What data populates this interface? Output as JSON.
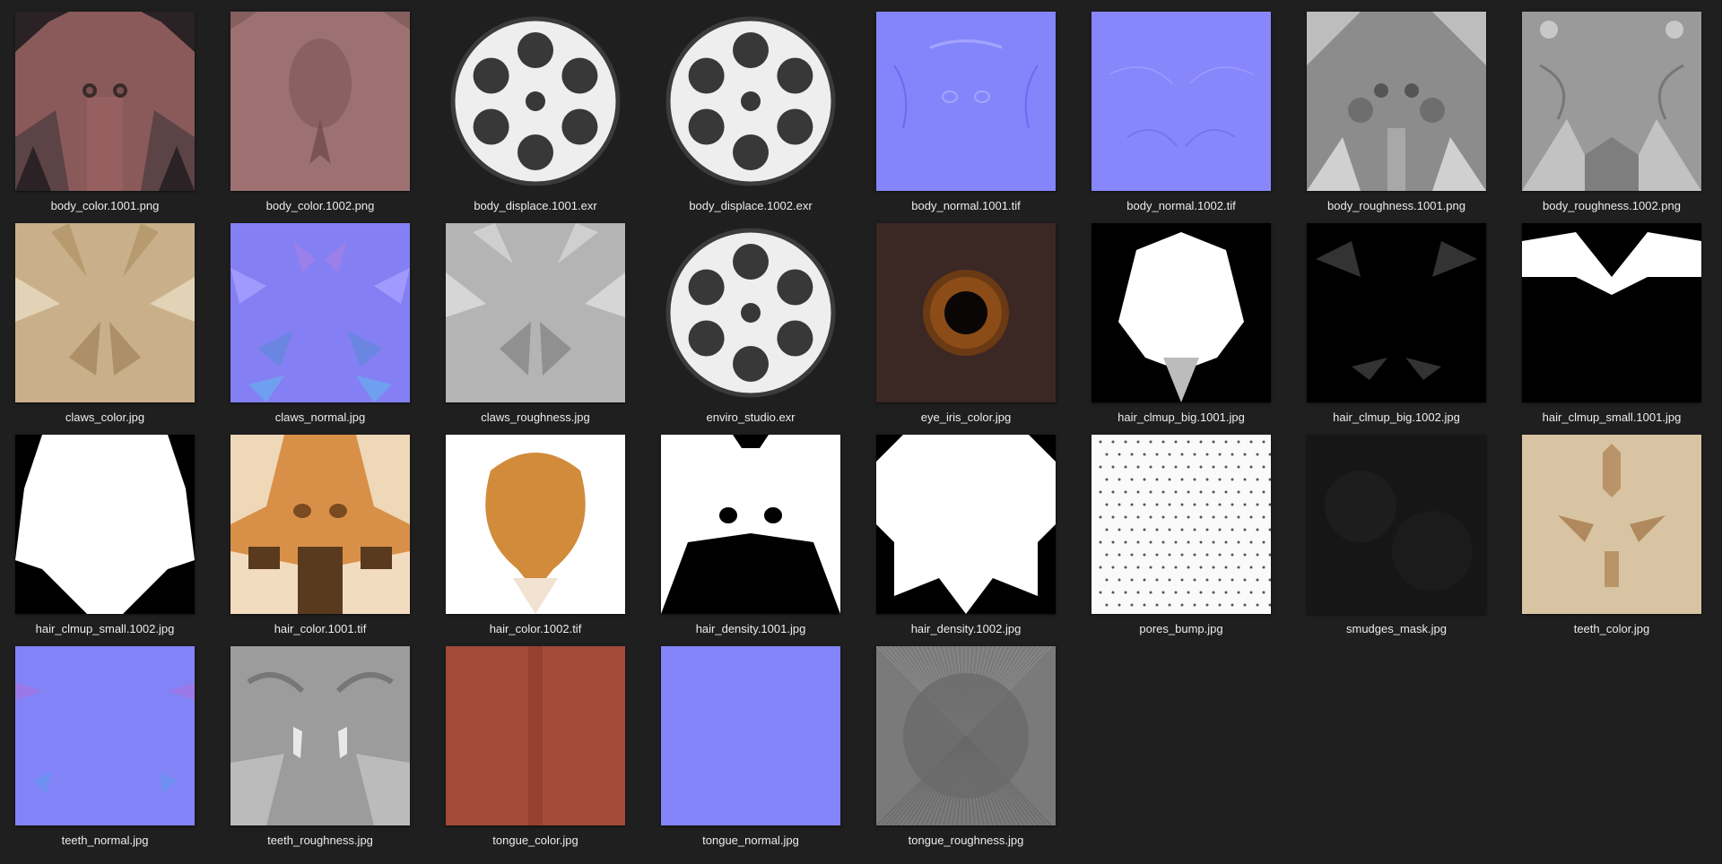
{
  "files": [
    {
      "name": "body_color.1001.png",
      "kind": "body_color_a"
    },
    {
      "name": "body_color.1002.png",
      "kind": "body_color_b"
    },
    {
      "name": "body_displace.1001.exr",
      "kind": "reel"
    },
    {
      "name": "body_displace.1002.exr",
      "kind": "reel"
    },
    {
      "name": "body_normal.1001.tif",
      "kind": "normal_a"
    },
    {
      "name": "body_normal.1002.tif",
      "kind": "normal_b"
    },
    {
      "name": "body_roughness.1001.png",
      "kind": "rough_a"
    },
    {
      "name": "body_roughness.1002.png",
      "kind": "rough_b"
    },
    {
      "name": "claws_color.jpg",
      "kind": "claws_color"
    },
    {
      "name": "claws_normal.jpg",
      "kind": "claws_normal"
    },
    {
      "name": "claws_roughness.jpg",
      "kind": "claws_rough"
    },
    {
      "name": "enviro_studio.exr",
      "kind": "reel"
    },
    {
      "name": "eye_iris_color.jpg",
      "kind": "iris"
    },
    {
      "name": "hair_clmup_big.1001.jpg",
      "kind": "clump_big_a"
    },
    {
      "name": "hair_clmup_big.1002.jpg",
      "kind": "clump_big_b"
    },
    {
      "name": "hair_clmup_small.1001.jpg",
      "kind": "clump_small_a"
    },
    {
      "name": "hair_clmup_small.1002.jpg",
      "kind": "clump_small_b"
    },
    {
      "name": "hair_color.1001.tif",
      "kind": "hair_color_a"
    },
    {
      "name": "hair_color.1002.tif",
      "kind": "hair_color_b"
    },
    {
      "name": "hair_density.1001.jpg",
      "kind": "density_a"
    },
    {
      "name": "hair_density.1002.jpg",
      "kind": "density_b"
    },
    {
      "name": "pores_bump.jpg",
      "kind": "pores"
    },
    {
      "name": "smudges_mask.jpg",
      "kind": "smudges"
    },
    {
      "name": "teeth_color.jpg",
      "kind": "teeth_color"
    },
    {
      "name": "teeth_normal.jpg",
      "kind": "teeth_normal"
    },
    {
      "name": "teeth_roughness.jpg",
      "kind": "teeth_rough"
    },
    {
      "name": "tongue_color.jpg",
      "kind": "tongue_color"
    },
    {
      "name": "tongue_normal.jpg",
      "kind": "tongue_normal"
    },
    {
      "name": "tongue_roughness.jpg",
      "kind": "tongue_rough"
    }
  ]
}
